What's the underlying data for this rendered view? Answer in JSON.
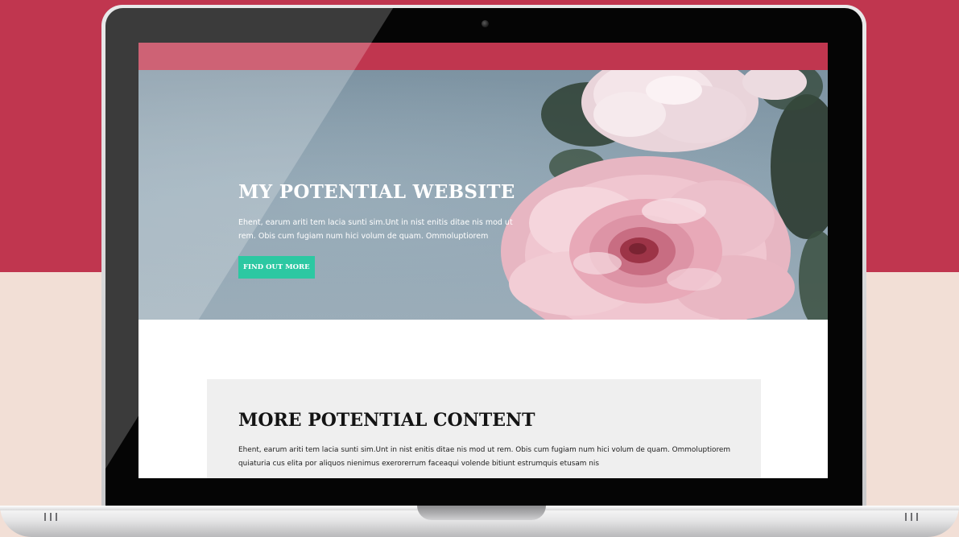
{
  "page": {
    "background_top_color": "#c0364f",
    "background_bottom_color": "#f2dfd6"
  },
  "site": {
    "header_color": "#c0364f",
    "hero": {
      "title": "MY POTENTIAL WEBSITE",
      "description": "Ehent, earum ariti tem lacia sunti sim.Unt in nist enitis ditae nis mod ut rem. Obis cum fugiam num hici volum de quam. Ommoluptiorem",
      "button_label": "FIND OUT MORE",
      "button_color": "#2cc8a2",
      "image": "pink-peony-flowers"
    },
    "content": {
      "title": "MORE POTENTIAL CONTENT",
      "text": "Ehent, earum ariti tem lacia sunti sim.Unt in nist enitis ditae nis mod ut rem. Obis cum fugiam num hici volum de quam. Ommoluptiorem quiaturia cus elita por aliquos nienimus exerorerrum faceaqui volende bitiunt estrumquis etusam nis"
    }
  },
  "device": {
    "type": "laptop",
    "icons": [
      "camera-icon",
      "vent-icon"
    ]
  }
}
